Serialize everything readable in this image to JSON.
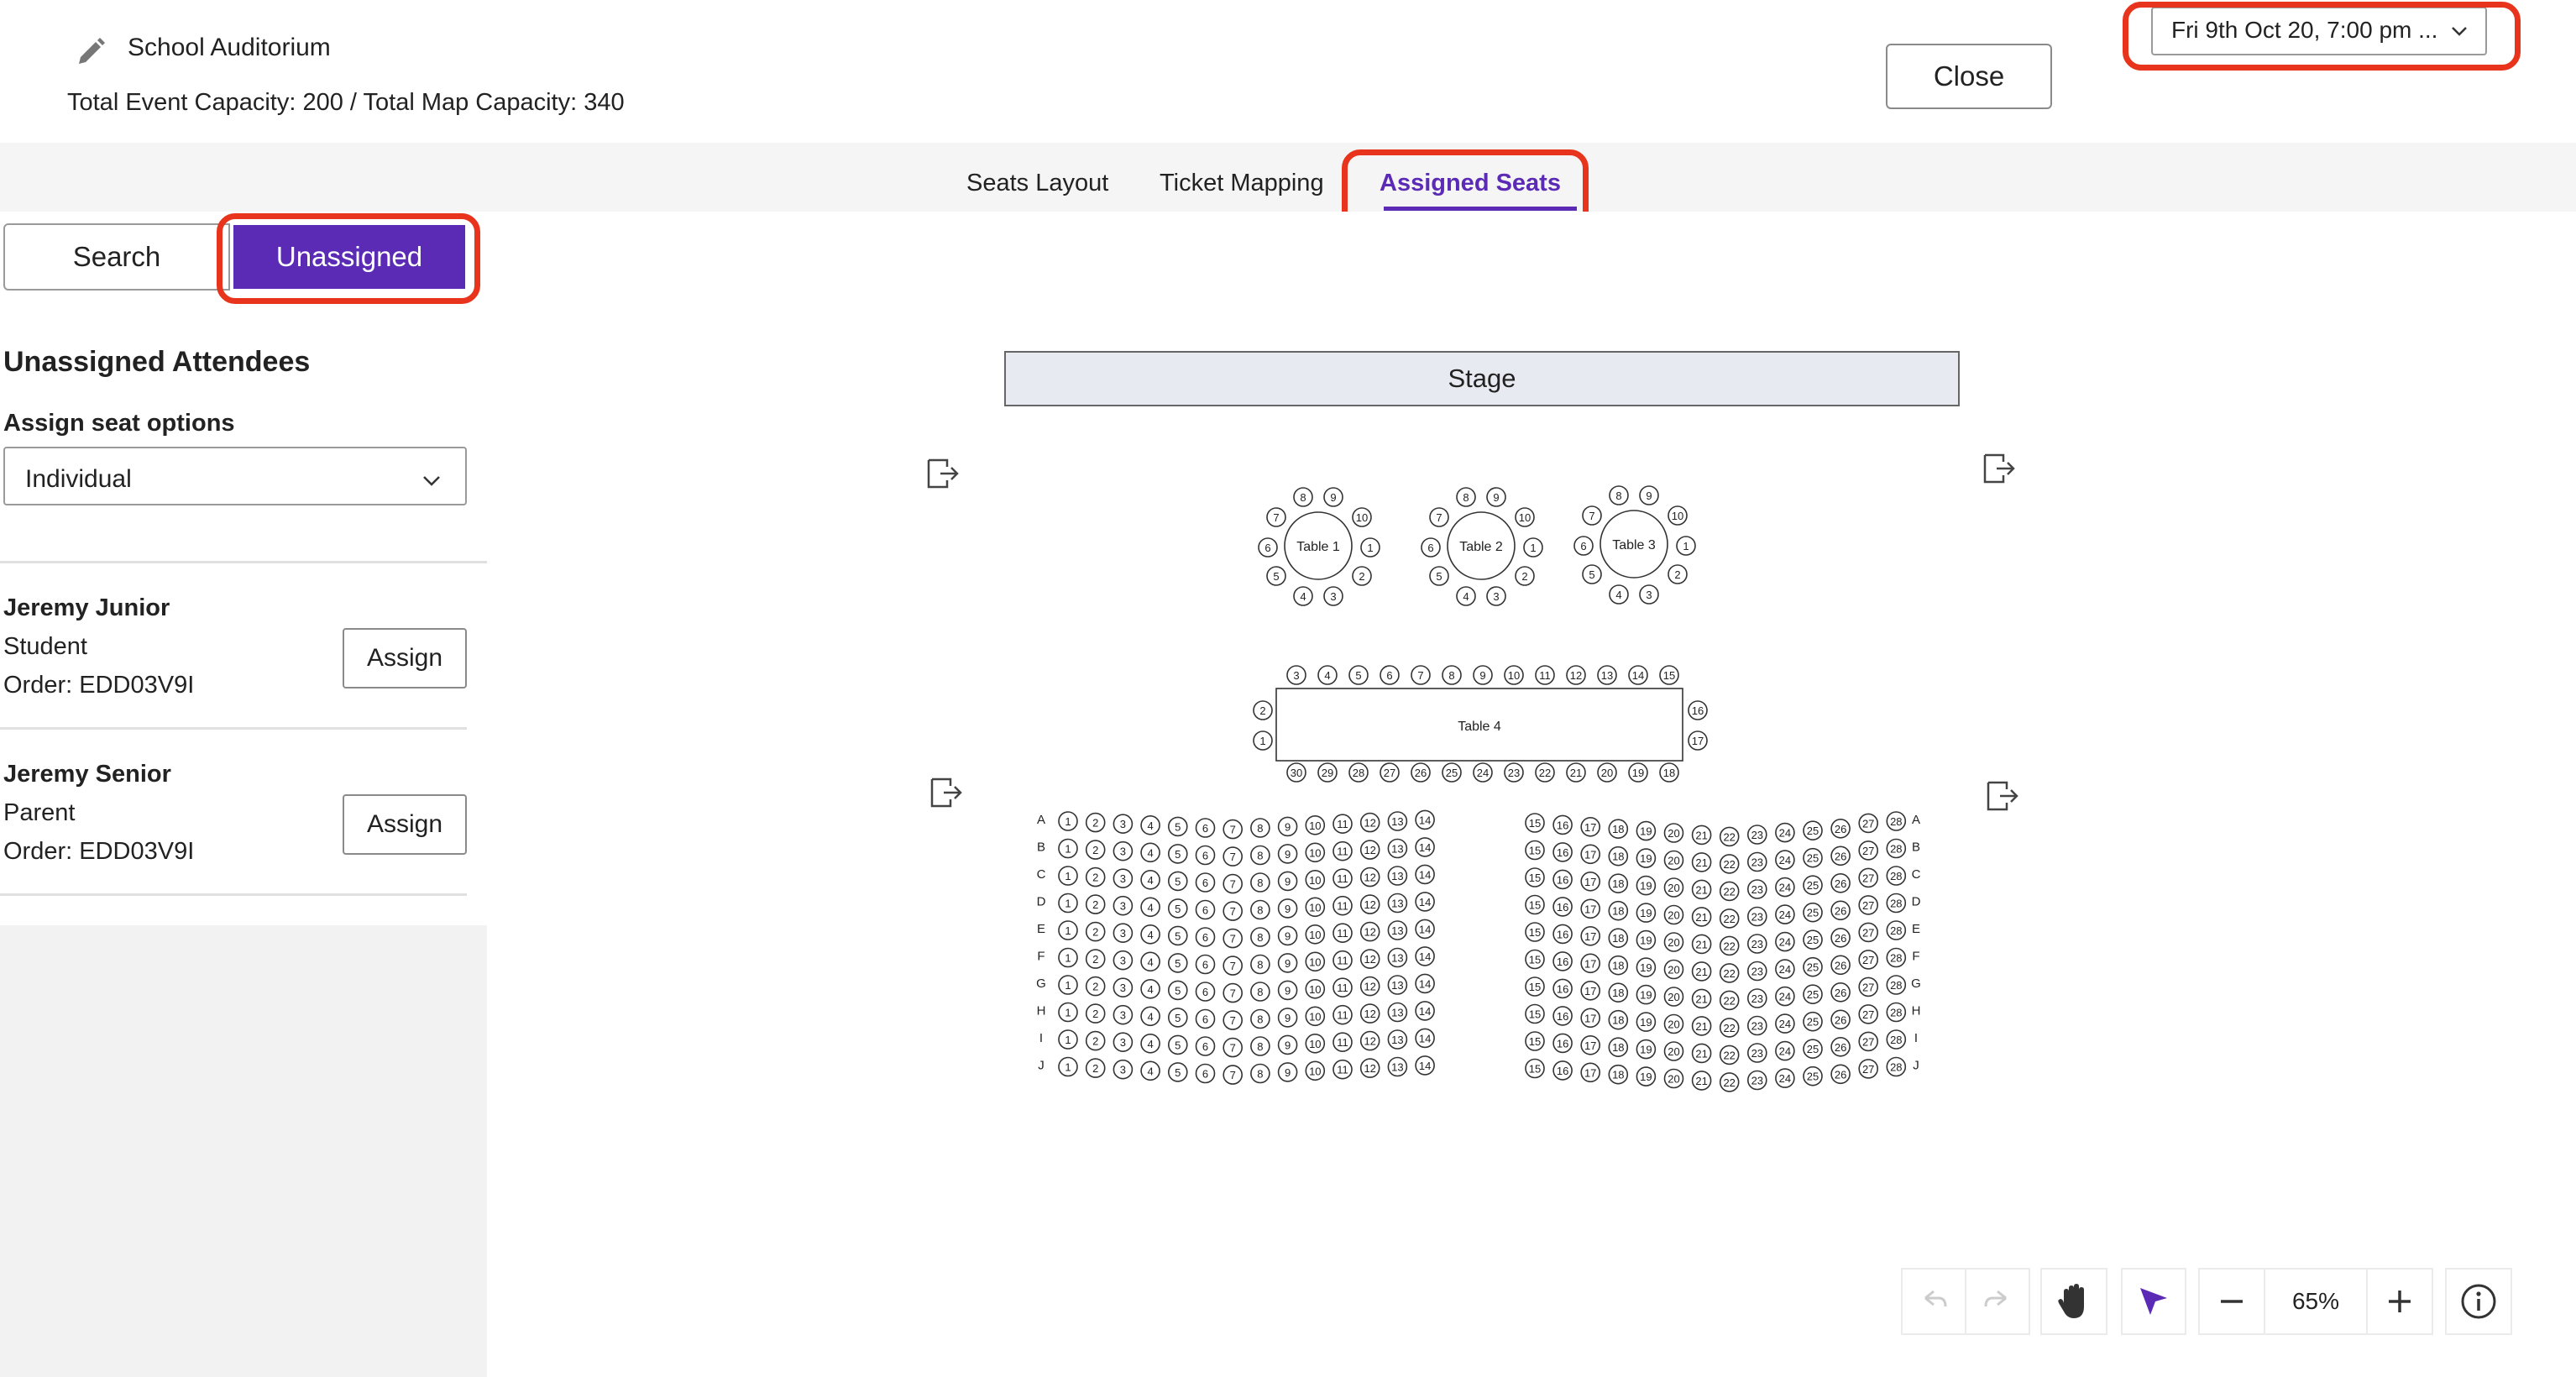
{
  "header": {
    "venue_name": "School Auditorium",
    "capacity_text": "Total Event Capacity: 200 / Total Map Capacity: 340",
    "close_label": "Close",
    "date_selected": "Fri 9th Oct 20, 7:00 pm ..."
  },
  "tabs": [
    {
      "label": "Seats Layout"
    },
    {
      "label": "Ticket Mapping"
    },
    {
      "label": "Assigned Seats"
    }
  ],
  "sidebar": {
    "search_label": "Search",
    "unassigned_label": "Unassigned",
    "title": "Unassigned Attendees",
    "assign_options_label": "Assign seat options",
    "assign_option_selected": "Individual",
    "attendees": [
      {
        "name": "Jeremy Junior",
        "role": "Student",
        "order": "Order: EDD03V9I",
        "button": "Assign"
      },
      {
        "name": "Jeremy Senior",
        "role": "Parent",
        "order": "Order: EDD03V9I",
        "button": "Assign"
      }
    ]
  },
  "map": {
    "stage_label": "Stage",
    "round_tables": [
      "Table 1",
      "Table 2",
      "Table 3"
    ],
    "long_table": {
      "label": "Table 4",
      "top_seats": [
        3,
        4,
        5,
        6,
        7,
        8,
        9,
        10,
        11,
        12,
        13,
        14,
        15
      ],
      "bottom_seats": [
        30,
        29,
        28,
        27,
        26,
        25,
        24,
        23,
        22,
        21,
        20,
        19,
        18
      ],
      "left_seats": [
        2,
        1
      ],
      "right_seats": [
        16,
        17
      ]
    },
    "round_seats": [
      8,
      9,
      7,
      10,
      6,
      1,
      5,
      2,
      4,
      3
    ],
    "row_letters": [
      "A",
      "B",
      "C",
      "D",
      "E",
      "F",
      "G",
      "H",
      "I",
      "J"
    ],
    "left_block_seats": [
      1,
      2,
      3,
      4,
      5,
      6,
      7,
      8,
      9,
      10,
      11,
      12,
      13,
      14
    ],
    "right_block_seats": [
      15,
      16,
      17,
      18,
      19,
      20,
      21,
      22,
      23,
      24,
      25,
      26,
      27,
      28
    ]
  },
  "toolbar": {
    "zoom": "65%",
    "icons": [
      "undo-icon",
      "redo-icon",
      "hand-icon",
      "pointer-icon",
      "minus-icon",
      "plus-icon",
      "info-icon"
    ],
    "accent": "#5b2bb5"
  },
  "colors": {
    "accent": "#5b2bb5",
    "highlight": "#e8341c"
  }
}
